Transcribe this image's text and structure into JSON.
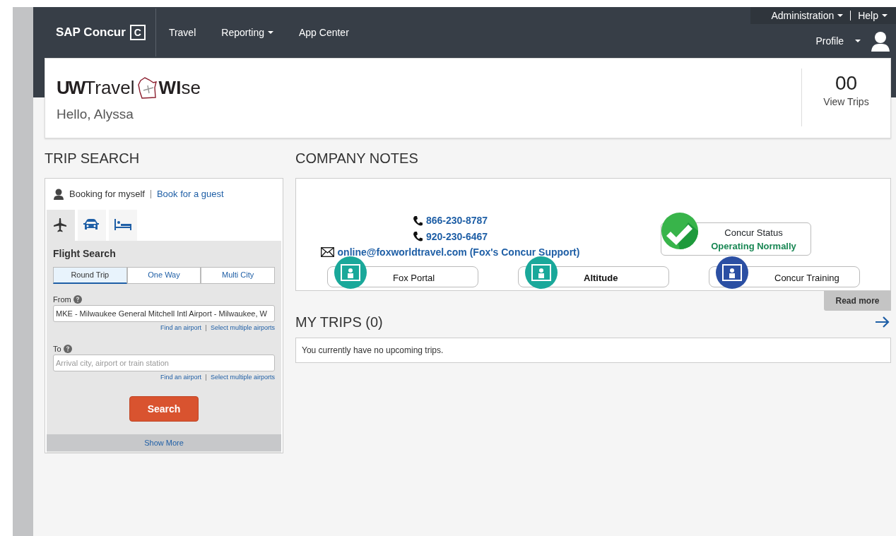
{
  "header": {
    "brand": "SAP Concur",
    "brand_mark": "C",
    "nav": [
      {
        "label": "Travel",
        "dropdown": false
      },
      {
        "label": "Reporting",
        "dropdown": true
      },
      {
        "label": "App Center",
        "dropdown": false
      }
    ],
    "utility": [
      {
        "label": "Administration",
        "dropdown": true
      },
      {
        "label": "Help",
        "dropdown": true
      }
    ],
    "profile": {
      "label": "Profile",
      "dropdown": true
    }
  },
  "welcome": {
    "logo": [
      "UW",
      "Travel",
      "WI",
      "se"
    ],
    "greeting": "Hello, Alyssa",
    "trip_count": "00",
    "trips_link": "View Trips"
  },
  "trip_search": {
    "title": "TRIP SEARCH",
    "booking_for": "Booking for myself",
    "guest_link": "Book for a guest",
    "tabs": [
      {
        "kind": "flight",
        "selected": true
      },
      {
        "kind": "car",
        "selected": false
      },
      {
        "kind": "hotel",
        "selected": false
      }
    ],
    "form_title": "Flight Search",
    "trip_types": [
      {
        "label": "Round Trip",
        "selected": true
      },
      {
        "label": "One Way",
        "selected": false
      },
      {
        "label": "Multi City",
        "selected": false
      }
    ],
    "fields": [
      {
        "label": "From",
        "value": "MKE - Milwaukee General Mitchell Intl Airport - Milwaukee, W",
        "links": [
          "Find an airport",
          "Select multiple airports"
        ]
      },
      {
        "label": "To",
        "placeholder": "Arrival city, airport or train station",
        "links": [
          "Find an airport",
          "Select multiple airports"
        ]
      }
    ],
    "search_button": "Search",
    "show_more": "Show More"
  },
  "company_notes": {
    "title": "COMPANY NOTES",
    "phones": [
      "866-230-8787",
      "920-230-6467"
    ],
    "email": "online@foxworldtravel.com (Fox's Concur Support)",
    "status": {
      "title": "Concur Status",
      "value": "Operating Normally"
    },
    "tiles": [
      {
        "label": "Fox Portal",
        "color": "#1aa89a"
      },
      {
        "label": "Altitude",
        "color": "#1aa89a"
      },
      {
        "label": "Concur Training",
        "color": "#2b4fa3"
      }
    ],
    "read_more": "Read more"
  },
  "my_trips": {
    "title": "MY TRIPS (0)",
    "message": "You currently have no upcoming trips."
  }
}
